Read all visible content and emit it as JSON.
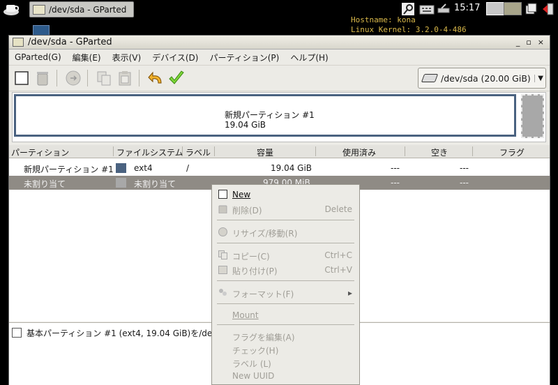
{
  "taskbar": {
    "task_label": "/dev/sda - GParted",
    "clock": "15:17"
  },
  "conky": {
    "hostname": "Hostname: kona",
    "kernel": "Linux Kernel: 3.2.0-4-486"
  },
  "window": {
    "title": "/dev/sda - GParted",
    "controls": [
      "_",
      "▫",
      "×"
    ]
  },
  "menubar": [
    "GParted(G)",
    "編集(E)",
    "表示(V)",
    "デバイス(D)",
    "パーティション(P)",
    "ヘルプ(H)"
  ],
  "device_selector": {
    "label": "/dev/sda  (20.00 GiB)"
  },
  "disk_map": {
    "partition_name": "新規パーティション #1",
    "partition_size": "19.04 GiB"
  },
  "columns": [
    "パーティション",
    "ファイルシステム",
    "ラベル",
    "容量",
    "使用済み",
    "空き",
    "フラグ"
  ],
  "rows": [
    {
      "partition": "新規パーティション #1",
      "fs": "ext4",
      "label": "/",
      "size": "19.04 GiB",
      "used": "---",
      "free": "---",
      "color": "#4a6280"
    },
    {
      "partition": "未割り当て",
      "fs": "未割り当て",
      "label": "",
      "size": "979.00 MiB",
      "used": "---",
      "free": "---",
      "color": "#a8a8a8"
    }
  ],
  "pending": {
    "operation": "基本パーティション #1 (ext4, 19.04 GiB)を/dev"
  },
  "context_menu": {
    "new": "New",
    "delete": "削除(D)",
    "delete_acc": "Delete",
    "resize": "リサイズ/移動(R)",
    "copy": "コピー(C)",
    "copy_acc": "Ctrl+C",
    "paste": "貼り付け(P)",
    "paste_acc": "Ctrl+V",
    "format": "フォーマット(F)",
    "mount": "Mount",
    "flags": "フラグを編集(A)",
    "check": "チェック(H)",
    "label": "ラベル (L)",
    "uuid": "New UUID"
  }
}
